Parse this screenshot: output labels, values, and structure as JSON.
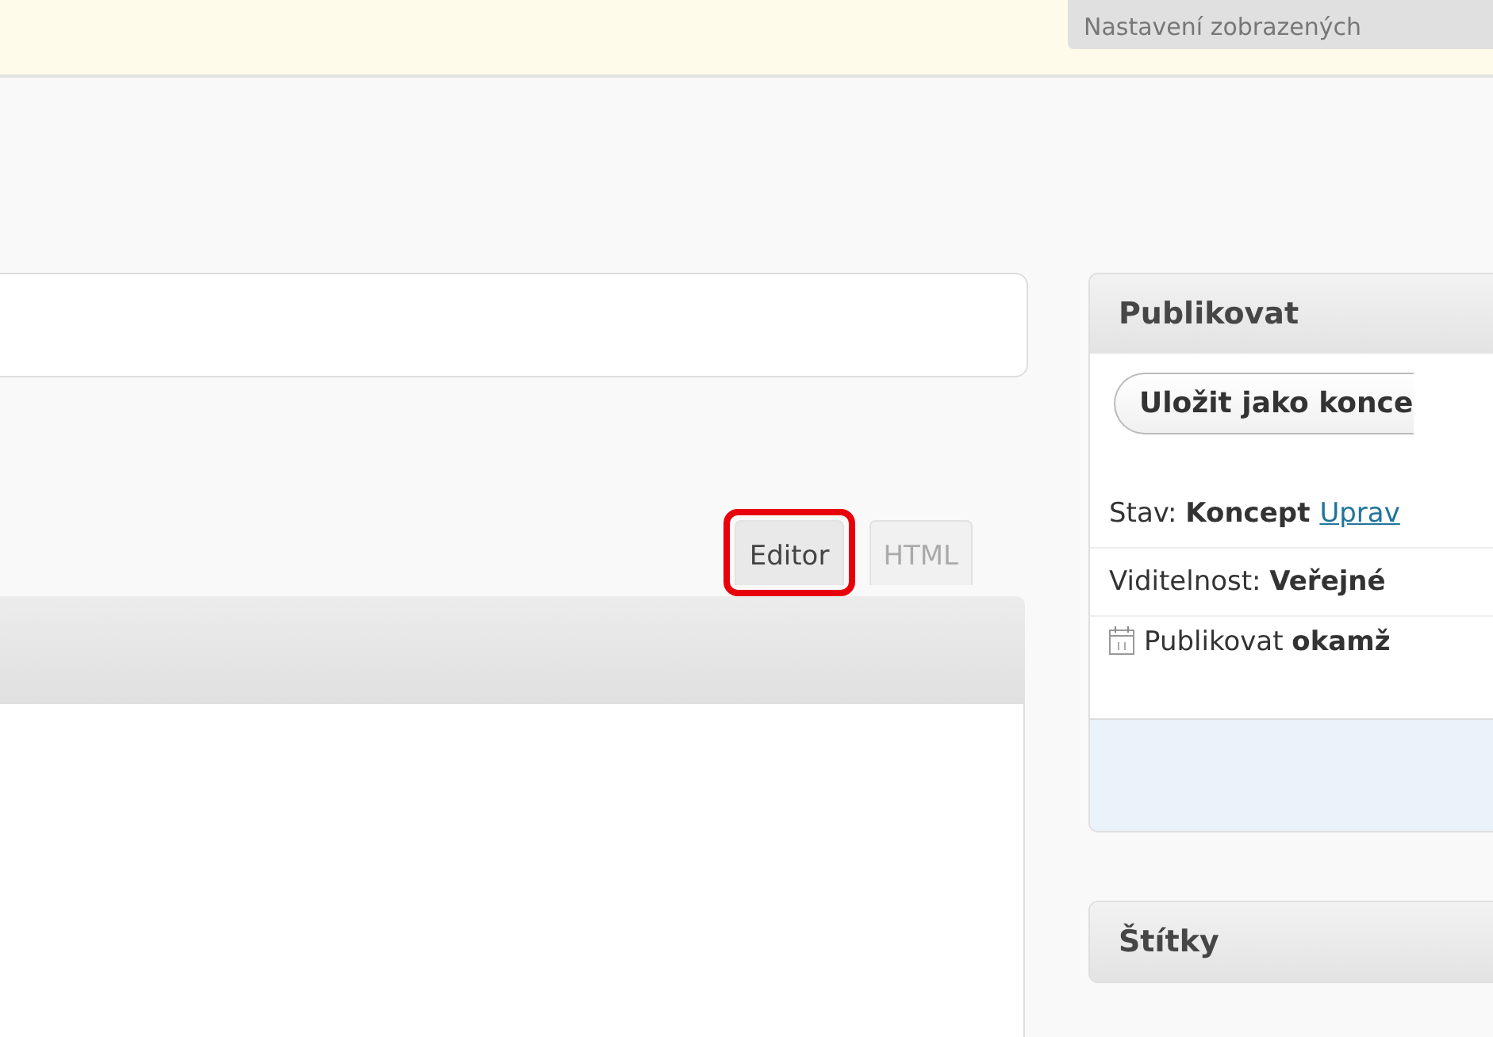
{
  "notice_bar": {
    "screen_options_button": "Nastavení zobrazených"
  },
  "editor": {
    "tabs": [
      {
        "label": "Editor",
        "selected": true,
        "highlighted": true
      },
      {
        "label": "HTML",
        "selected": false,
        "highlighted": false
      }
    ]
  },
  "publish_box": {
    "title": "Publikovat",
    "save_draft_button": "Uložit jako konce",
    "rows": [
      {
        "kind": "status",
        "text": "Stav: **Koncept**",
        "link": "Uprav"
      },
      {
        "kind": "visibility",
        "text": "Viditelnost: **Veřejné**"
      },
      {
        "kind": "schedule",
        "text": "Publikovat **okamž**"
      }
    ]
  },
  "tags_box": {
    "title": "Štítky"
  }
}
